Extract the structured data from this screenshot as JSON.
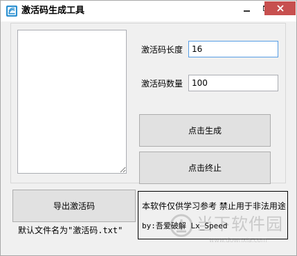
{
  "window": {
    "title": "激活码生成工具"
  },
  "form": {
    "length_label": "激活码长度",
    "length_value": "16",
    "quantity_label": "激活码数量",
    "quantity_value": "100"
  },
  "buttons": {
    "generate": "点击生成",
    "stop": "点击终止",
    "export": "导出激活码"
  },
  "export": {
    "default_filename_note": "默认文件名为\"激活码.txt\""
  },
  "notice": {
    "disclaimer": "本软件仅供学习参考 禁止用于非法用途",
    "credit": "by:吾爱破解 Lx_Speed"
  },
  "watermark": {
    "text": "当下软件园",
    "url": "www.downxia.com"
  },
  "colors": {
    "close_button": "#c7504f",
    "focus_border": "#569de5",
    "window_bg": "#f0f0f0",
    "button_bg": "#e1e1e1"
  },
  "icons": {
    "app": "app-icon",
    "minimize": "minimize-icon",
    "maximize": "maximize-icon",
    "close": "close-icon"
  }
}
